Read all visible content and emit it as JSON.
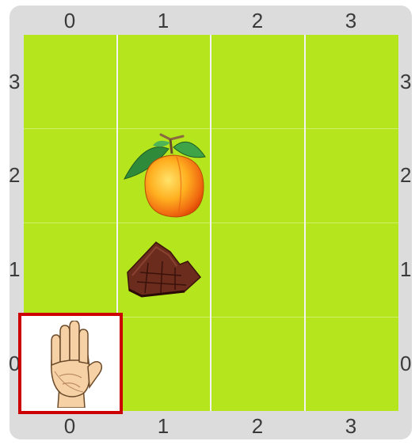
{
  "grid": {
    "columns": [
      "0",
      "1",
      "2",
      "3"
    ],
    "rows": [
      "3",
      "2",
      "1",
      "0"
    ]
  },
  "colors": {
    "board": "#b5e51d",
    "frame": "#dcdcdc",
    "highlight_border": "#cc0000",
    "line": "#f2f2f2"
  },
  "pieces": [
    {
      "name": "hand",
      "icon": "hand-icon",
      "col": 0,
      "row": 0,
      "selected": true
    },
    {
      "name": "peach",
      "icon": "peach-icon",
      "col": 1,
      "row": 2
    },
    {
      "name": "chocolate",
      "icon": "chocolate-icon",
      "col": 1,
      "row": 1
    }
  ]
}
